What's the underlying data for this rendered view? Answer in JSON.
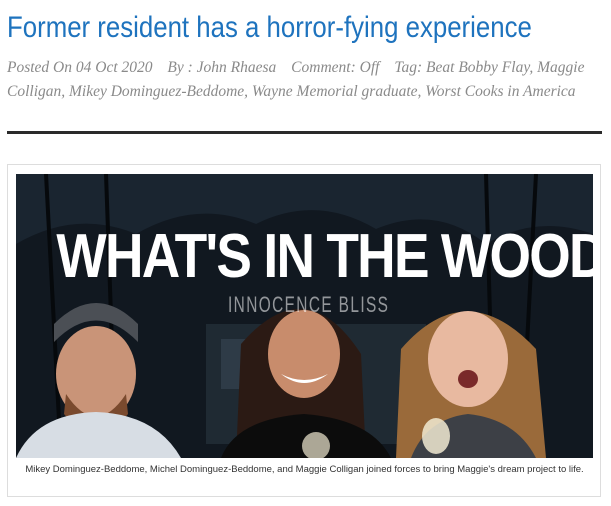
{
  "article": {
    "title": "Former resident has a horror-fying experience",
    "meta": {
      "posted": "Posted On 04 Oct 2020",
      "author": "By : John Rhaesa",
      "comment": "Comment: Off",
      "tags": "Tag: Beat Bobby Flay, Maggie Colligan, Mikey Dominguez-Beddome, Wayne Memorial graduate, Worst Cooks in America"
    }
  },
  "figure": {
    "headline": "WHAT'S IN THE WOODS?",
    "subhead": "INNOCENCE BLISS",
    "caption": "Mikey Dominguez-Beddome, Michel Dominguez-Beddome, and Maggie Colligan joined forces to bring Maggie's dream project to life."
  },
  "colors": {
    "title": "#1e73be",
    "meta": "#8a8a8a",
    "rule": "#2a2a2a"
  }
}
